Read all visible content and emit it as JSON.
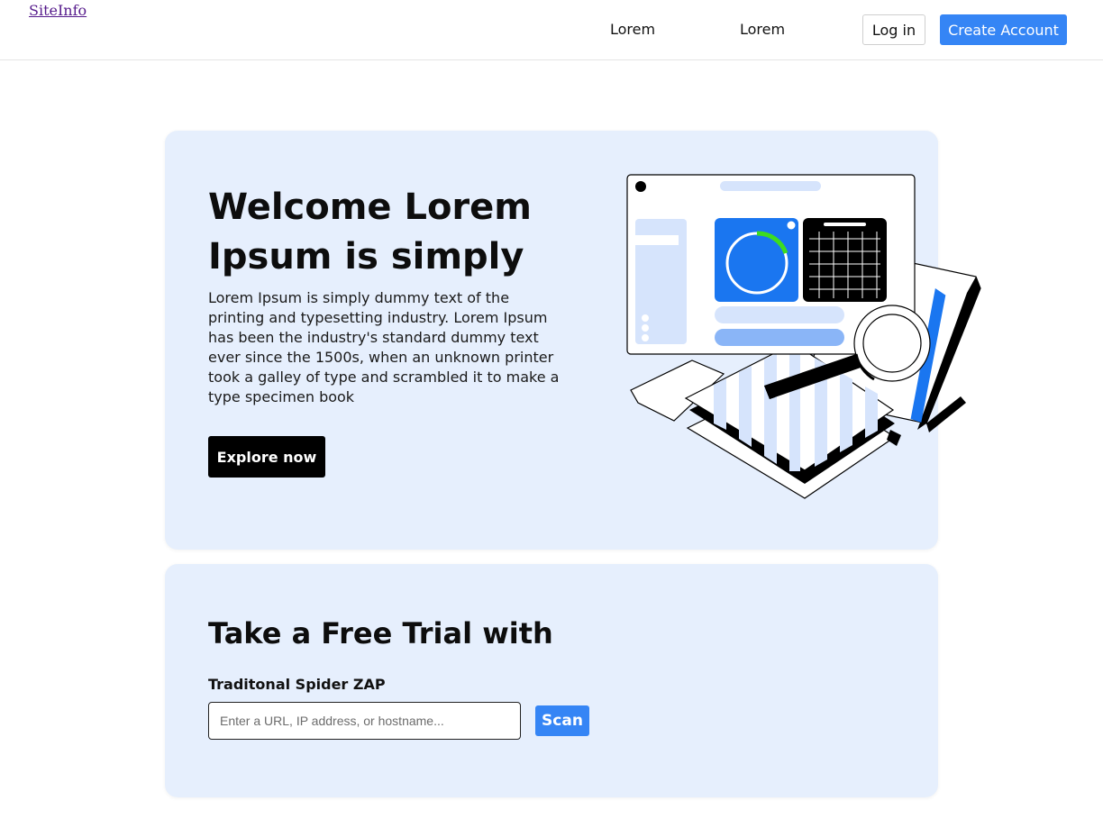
{
  "header": {
    "brand": "SiteInfo",
    "nav_links": [
      "Lorem",
      "Lorem"
    ],
    "login_label": "Log in",
    "create_account_label": "Create Account"
  },
  "hero": {
    "title": "Welcome Lorem Ipsum is simply",
    "description": "Lorem Ipsum is simply dummy text of the printing and typesetting industry. Lorem Ipsum has been the industry's standard dummy text ever since the 1500s, when an unknown printer took a galley of type and scrambled it to make a type specimen book",
    "cta_label": "Explore now"
  },
  "trial": {
    "title": "Take a Free Trial with",
    "field_label": "Traditonal Spider ZAP",
    "url_placeholder": "Enter a URL, IP address, or hostname...",
    "url_value": "",
    "scan_label": "Scan"
  },
  "colors": {
    "accent": "#3585f5",
    "card_bg": "#e6effd",
    "illustration_blue": "#1a76f0",
    "illustration_green": "#3ddc1f"
  },
  "icons": {
    "hero_illustration": "dashboard-magnifier-illustration"
  }
}
